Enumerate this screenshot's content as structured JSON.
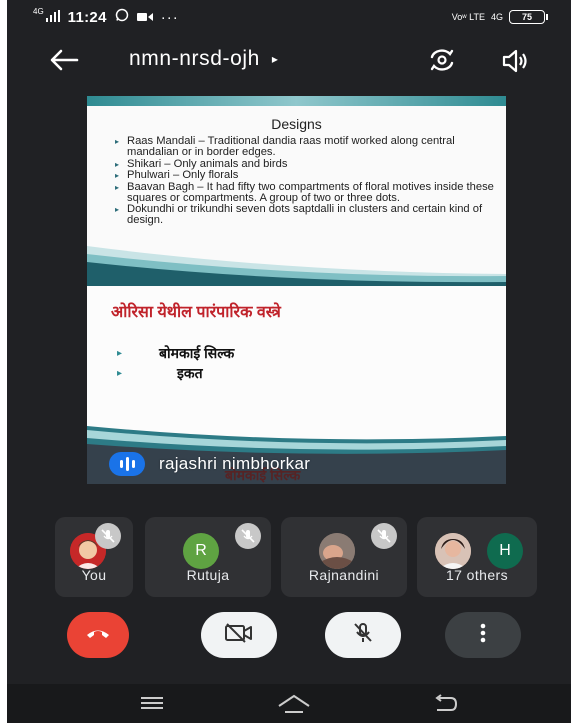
{
  "status_bar": {
    "network_tag": "4G",
    "time": "11:24",
    "extra_icons": [
      "whatsapp-icon",
      "video-icon"
    ],
    "more_dots": "···",
    "volte_label": "Voʷ LTE",
    "net_right": "4G",
    "battery": "75"
  },
  "meeting": {
    "title": "nmn-nrsd-ojh",
    "title_caret": "▸"
  },
  "slide": {
    "title": "Designs",
    "bullets": [
      "Raas Mandali – Traditional dandia raas motif worked along central mandalian or in border edges.",
      "Shikari – Only animals and birds",
      "Phulwari – Only florals",
      "Baavan Bagh – It had fifty two compartments of floral motives inside these squares or compartments. A group of two or three dots.",
      "Dokundhi or trikundhi seven dots saptdalli in clusters and certain kind of design."
    ],
    "slide2_title": "ओरिसा येथील पारंपारिक वस्त्रे",
    "slide2_items": [
      "बोमकाई सिल्क",
      "इकत"
    ],
    "slide2_arrow": "▸",
    "partial_text": "बोमकाई सिल्क"
  },
  "presenter": {
    "name": "rajashri nimbhorkar"
  },
  "participants": [
    {
      "name": "You",
      "muted": true
    },
    {
      "name": "Rutuja",
      "initial": "R",
      "avatar_color": "#5fa342",
      "muted": true
    },
    {
      "name": "Rajnandini",
      "muted": true
    },
    {
      "name": "17 others",
      "initial": "H",
      "avatar_color": "#0f6b4f"
    }
  ],
  "controls": {
    "end_call": "end-call-icon",
    "camera": "camera-off-icon",
    "mic": "mic-off-icon",
    "more": "more-vert-icon"
  },
  "colors": {
    "background": "#202124",
    "tile": "#303134",
    "end_call": "#ea4335",
    "control_light": "#f1f3f4",
    "control_dark": "#3c4043",
    "presenter_badge": "#1a73e8",
    "slide_heading_red": "#c0232b",
    "slide_teal": "#2f8b92"
  }
}
